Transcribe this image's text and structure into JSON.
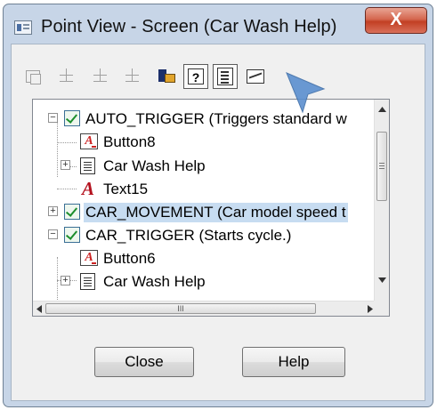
{
  "window": {
    "title": "Point View - Screen (Car Wash Help)",
    "close_glyph": "X"
  },
  "toolbar": {
    "buttons": [
      {
        "icon": "properties-icon",
        "enabled": false
      },
      {
        "icon": "tree-icon",
        "enabled": false
      },
      {
        "icon": "expand-tree-icon",
        "enabled": false
      },
      {
        "icon": "collapse-tree-icon",
        "enabled": false
      },
      {
        "icon": "book-icon",
        "enabled": true
      },
      {
        "icon": "help-icon",
        "label": "?",
        "pressed": true
      },
      {
        "icon": "list-icon",
        "pressed": true
      },
      {
        "icon": "chart-icon",
        "enabled": true
      }
    ]
  },
  "tree": {
    "items": [
      {
        "label": "AUTO_TRIGGER (Triggers standard w",
        "type": "point",
        "expander": "−",
        "checked": true
      },
      {
        "label": "Button8",
        "type": "button"
      },
      {
        "label": "Car Wash Help",
        "type": "screen",
        "expander": "+"
      },
      {
        "label": "Text15",
        "type": "text"
      },
      {
        "label": "CAR_MOVEMENT (Car model speed t",
        "type": "point",
        "expander": "+",
        "checked": true,
        "selected": true
      },
      {
        "label": "CAR_TRIGGER (Starts cycle.)",
        "type": "point",
        "expander": "−",
        "checked": true
      },
      {
        "label": "Button6",
        "type": "button"
      },
      {
        "label": "Car Wash Help",
        "type": "screen",
        "expander": "+"
      }
    ],
    "hscroll_grip": "III"
  },
  "buttons": {
    "close_label": "Close",
    "help_label": "Help"
  },
  "colors": {
    "selection": "#c7dcf1",
    "frame": "#c7d5e7",
    "close_button": "#c94a30",
    "cursor": "#5b8fcf"
  }
}
